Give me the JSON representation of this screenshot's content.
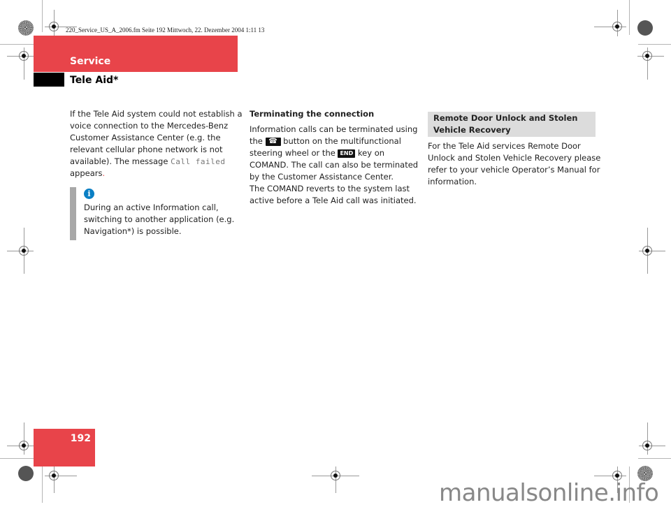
{
  "file_header": "220_Service_US_A_2006.fm  Seite 192  Mittwoch, 22. Dezember 2004  1:11 13",
  "section_title": "Service",
  "sub_title": "Tele Aid*",
  "column1": {
    "para_before": "If the Tele Aid system could not establish a voice connection to the Mercedes-Benz Customer Assistance Center (e.g. the relevant cellular phone network is not available). The message ",
    "display_message": "Call failed",
    "para_after": "appears",
    "para_end": "."
  },
  "note": {
    "icon": "info-icon",
    "icon_glyph": "i",
    "text": "During an active Information call, switching to another application (e.g. Navigation*) is possible."
  },
  "column2": {
    "heading": "Terminating the connection",
    "text_1": "Information calls can be terminated using the ",
    "phone_key_icon": "phone-hang-up-icon",
    "phone_key_glyph": "☎",
    "text_2": " button on the multifunctional steering wheel or the ",
    "end_key_label": "END",
    "text_3": " key on COMAND. The call can also be terminated by the Customer Assistance Center.",
    "text_4": "The COMAND reverts to the system last active before a Tele Aid call was initiated."
  },
  "column3": {
    "heading": "Remote Door Unlock and Stolen Vehicle Recovery",
    "text": "For the Tele Aid services Remote Door Unlock and Stolen Vehicle Recovery please refer to your vehicle Operator’s Manual for information."
  },
  "page_number": "192",
  "watermark": "manualsonline.info",
  "colors": {
    "accent_red": "#e8444a",
    "info_blue": "#0a7fc4",
    "note_bar_gray": "#a8a8a8",
    "heading_box_gray": "#dcdcdc"
  }
}
